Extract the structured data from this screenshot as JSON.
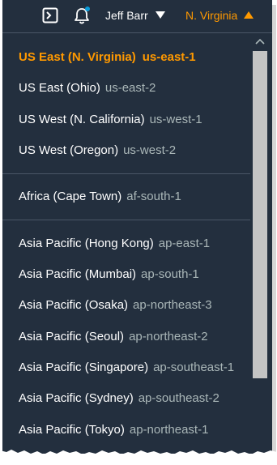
{
  "header": {
    "user_name": "Jeff Barr",
    "current_region": "N. Virginia",
    "icons": [
      "cloudshell-terminal-icon",
      "notification-bell-icon",
      "caret-down-icon",
      "caret-up-icon"
    ],
    "notification_dot_color": "#0a9bd9"
  },
  "regions": {
    "selected": {
      "name": "US East (N. Virginia)",
      "code": "us-east-1"
    },
    "groups": [
      [
        {
          "name": "US East (Ohio)",
          "code": "us-east-2"
        },
        {
          "name": "US West (N. California)",
          "code": "us-west-1"
        },
        {
          "name": "US West (Oregon)",
          "code": "us-west-2"
        }
      ],
      [
        {
          "name": "Africa (Cape Town)",
          "code": "af-south-1"
        }
      ],
      [
        {
          "name": "Asia Pacific (Hong Kong)",
          "code": "ap-east-1"
        },
        {
          "name": "Asia Pacific (Mumbai)",
          "code": "ap-south-1"
        },
        {
          "name": "Asia Pacific (Osaka)",
          "code": "ap-northeast-3"
        },
        {
          "name": "Asia Pacific (Seoul)",
          "code": "ap-northeast-2"
        },
        {
          "name": "Asia Pacific (Singapore)",
          "code": "ap-southeast-1"
        },
        {
          "name": "Asia Pacific (Sydney)",
          "code": "ap-southeast-2"
        },
        {
          "name": "Asia Pacific (Tokyo)",
          "code": "ap-northeast-1"
        }
      ]
    ]
  },
  "colors": {
    "background": "#232f3e",
    "accent": "#ff9900",
    "text": "#ffffff",
    "code_text": "#aab7b8",
    "divider": "#4a5666",
    "scrollbar_thumb": "#c4c4c4"
  }
}
